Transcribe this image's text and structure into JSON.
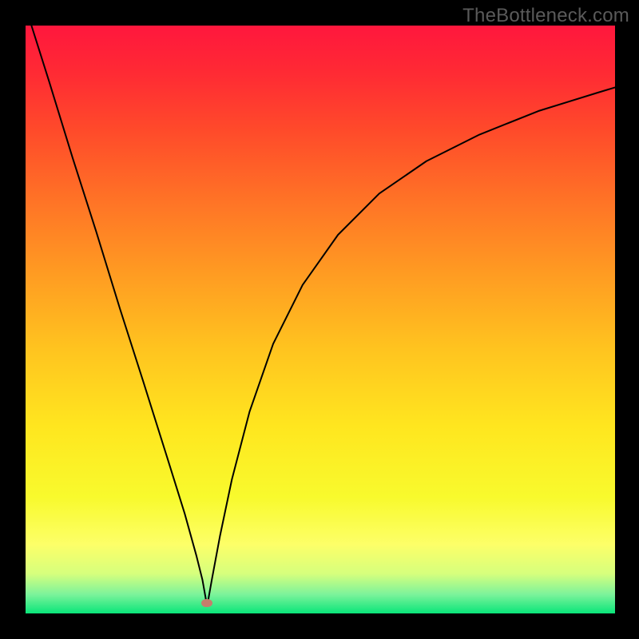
{
  "watermark": {
    "text": "TheBottleneck.com"
  },
  "gradient": {
    "stops": [
      {
        "offset": 0.0,
        "color": "#ff173d"
      },
      {
        "offset": 0.08,
        "color": "#ff2a34"
      },
      {
        "offset": 0.18,
        "color": "#ff4b2a"
      },
      {
        "offset": 0.3,
        "color": "#ff7426"
      },
      {
        "offset": 0.42,
        "color": "#ff9b22"
      },
      {
        "offset": 0.55,
        "color": "#ffc41f"
      },
      {
        "offset": 0.68,
        "color": "#ffe61f"
      },
      {
        "offset": 0.8,
        "color": "#f8fa2d"
      },
      {
        "offset": 0.88,
        "color": "#fdff68"
      },
      {
        "offset": 0.93,
        "color": "#d6ff7d"
      },
      {
        "offset": 0.965,
        "color": "#7cf39b"
      },
      {
        "offset": 1.0,
        "color": "#00e477"
      }
    ]
  },
  "marker": {
    "x_frac": 0.308,
    "y_frac": 0.982,
    "color": "#c77e6c"
  },
  "chart_data": {
    "type": "line",
    "title": "",
    "xlabel": "",
    "ylabel": "",
    "xlim": [
      0,
      1
    ],
    "ylim": [
      0,
      1
    ],
    "series": [
      {
        "name": "curve",
        "x": [
          0.01,
          0.04,
          0.08,
          0.12,
          0.16,
          0.2,
          0.24,
          0.27,
          0.29,
          0.3,
          0.308,
          0.316,
          0.33,
          0.35,
          0.38,
          0.42,
          0.47,
          0.53,
          0.6,
          0.68,
          0.77,
          0.87,
          0.97,
          1.0
        ],
        "y": [
          1.0,
          0.905,
          0.775,
          0.65,
          0.52,
          0.395,
          0.268,
          0.172,
          0.1,
          0.06,
          0.015,
          0.06,
          0.135,
          0.23,
          0.345,
          0.46,
          0.56,
          0.645,
          0.715,
          0.77,
          0.815,
          0.855,
          0.886,
          0.895
        ]
      }
    ],
    "minimum_point": {
      "x": 0.308,
      "y": 0.015
    }
  }
}
